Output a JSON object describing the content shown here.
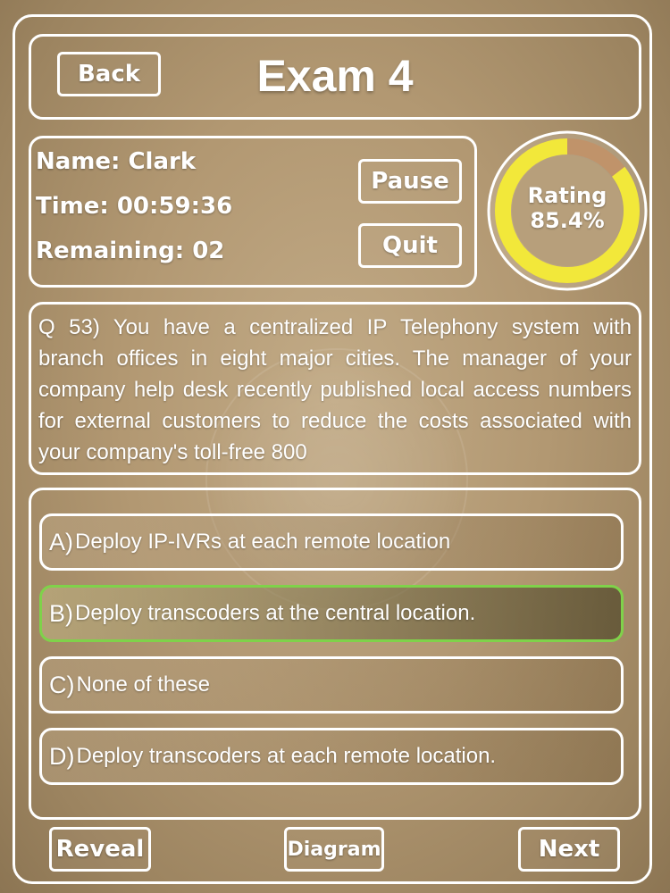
{
  "header": {
    "back_label": "Back",
    "title": "Exam 4"
  },
  "info": {
    "name": "Name: Clark",
    "time": "Time: 00:59:36",
    "remaining": "Remaining: 02",
    "pause_label": "Pause",
    "quit_label": "Quit"
  },
  "rating": {
    "label": "Rating",
    "value_text": "85.4%",
    "fraction": 0.854,
    "fill_color": "#f2e83a",
    "empty_color": "#c0936a"
  },
  "question": {
    "text": "Q 53)  You have a centralized IP Telephony system with branch offices in eight major cities. The manager of your company help desk recently published local access numbers for external customers to reduce the costs associated with your company's toll-free 800"
  },
  "options": [
    {
      "letter": "A)",
      "text": "Deploy IP-IVRs at each remote location"
    },
    {
      "letter": "B)",
      "text": "Deploy transcoders at the central location."
    },
    {
      "letter": "C)",
      "text": "None of these"
    },
    {
      "letter": "D)",
      "text": "Deploy transcoders at each remote location."
    }
  ],
  "selected_option": "B)",
  "footer": {
    "reveal_label": "Reveal",
    "diagram_label": "Diagram",
    "next_label": "Next"
  }
}
